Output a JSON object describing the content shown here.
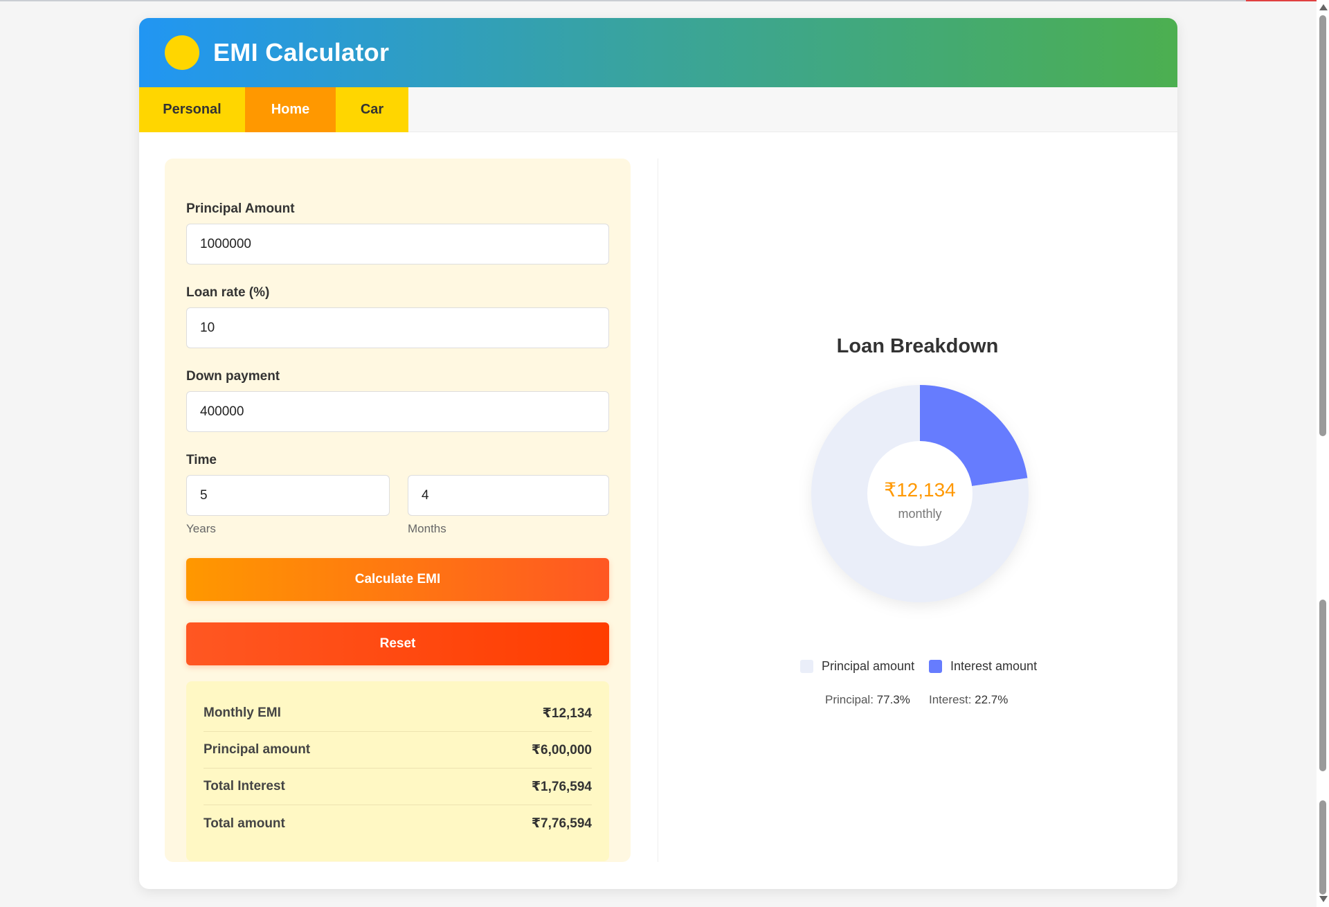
{
  "header": {
    "title": "EMI Calculator"
  },
  "tabs": [
    {
      "label": "Personal",
      "active": false
    },
    {
      "label": "Home",
      "active": true
    },
    {
      "label": "Car",
      "active": false
    }
  ],
  "form": {
    "principal_label": "Principal Amount",
    "principal_value": "1000000",
    "rate_label": "Loan rate (%)",
    "rate_value": "10",
    "down_label": "Down payment",
    "down_value": "400000",
    "time_label": "Time",
    "years_value": "5",
    "months_value": "4",
    "years_label": "Years",
    "months_label": "Months",
    "calculate_label": "Calculate EMI",
    "reset_label": "Reset"
  },
  "results": [
    {
      "label": "Monthly EMI",
      "value": "₹12,134"
    },
    {
      "label": "Principal amount",
      "value": "₹6,00,000"
    },
    {
      "label": "Total Interest",
      "value": "₹1,76,594"
    },
    {
      "label": "Total amount",
      "value": "₹7,76,594"
    }
  ],
  "chart": {
    "title": "Loan Breakdown",
    "center_value": "₹12,134",
    "center_label": "monthly",
    "legend_principal": "Principal amount",
    "legend_interest": "Interest amount",
    "principal_pct_label": "Principal:",
    "principal_pct_value": "77.3%",
    "interest_pct_label": "Interest:",
    "interest_pct_value": "22.7%"
  },
  "chart_data": {
    "type": "pie",
    "title": "Loan Breakdown",
    "categories": [
      "Principal amount",
      "Interest amount"
    ],
    "values": [
      77.3,
      22.7
    ],
    "colors": [
      "#eaeef9",
      "#667cfe"
    ]
  },
  "colors": {
    "accent_orange": "#ff9800",
    "tab_yellow": "#ffd600",
    "header_start": "#2196f3",
    "header_end": "#4caf50",
    "reset_red": "#ff3d00"
  }
}
